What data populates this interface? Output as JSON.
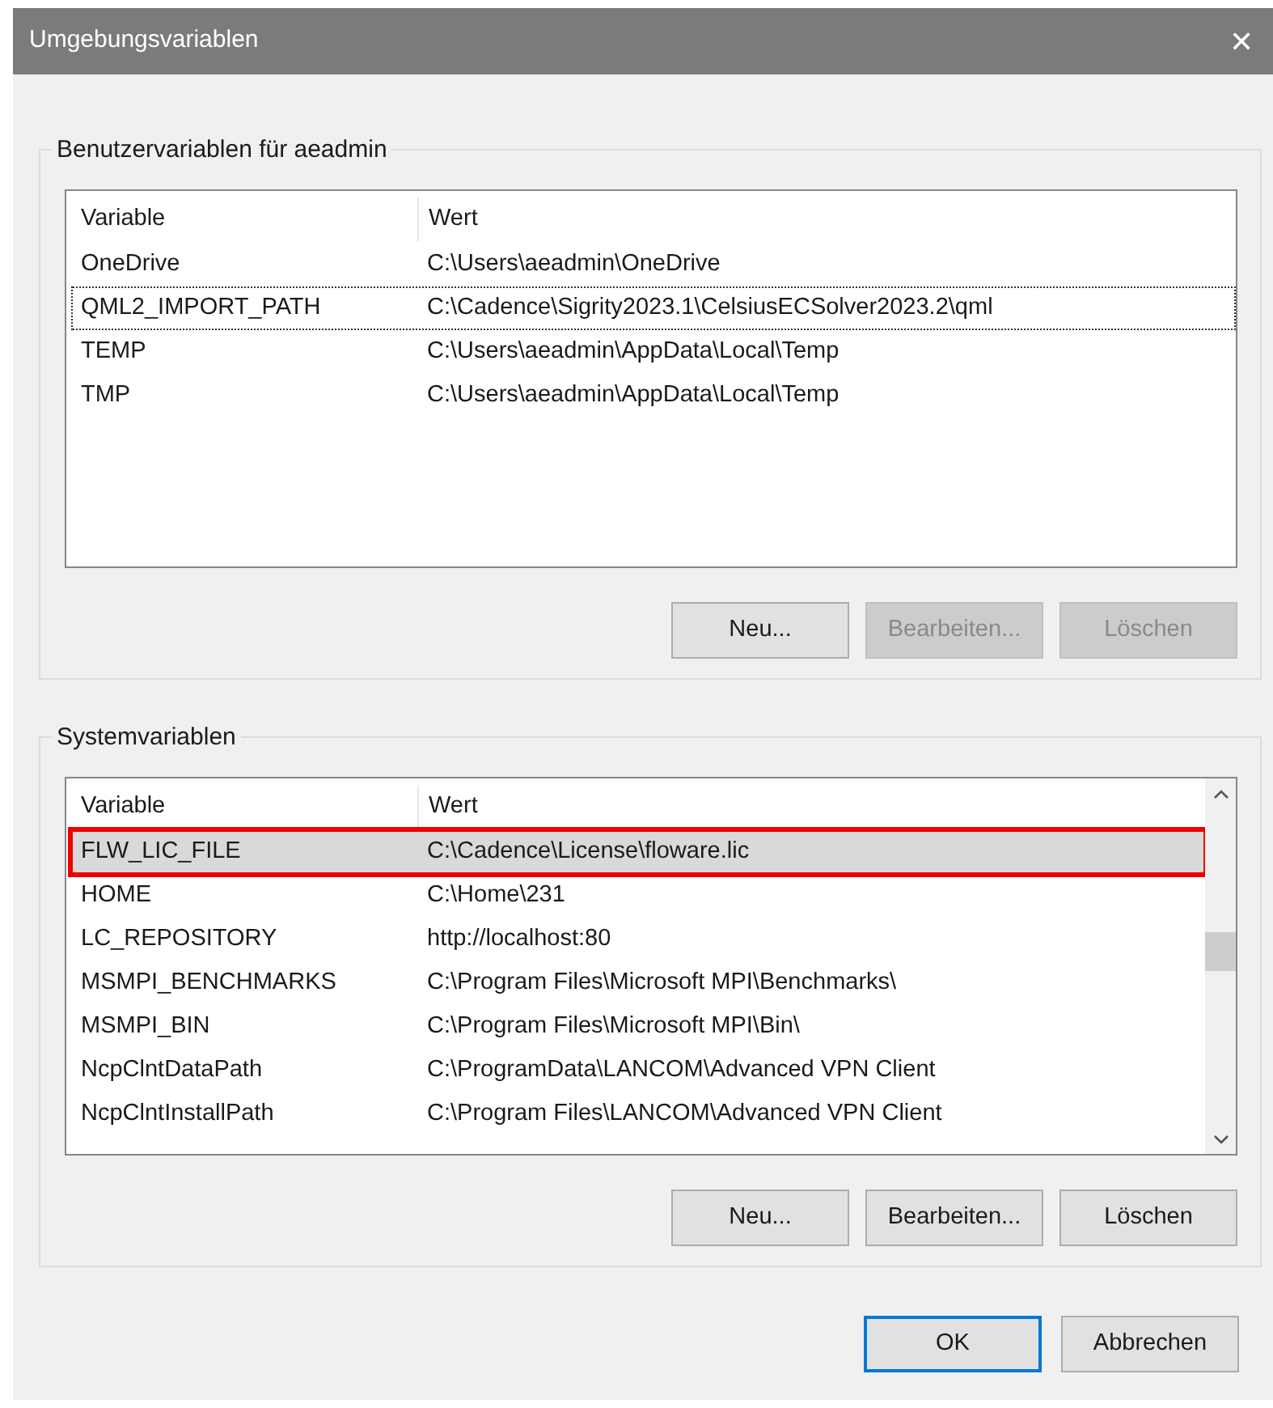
{
  "window": {
    "title": "Umgebungsvariablen",
    "close": "✕"
  },
  "groups": [
    {
      "title": "Benutzervariablen für aeadmin",
      "columns": [
        "Variable",
        "Wert"
      ],
      "scrollbar": false,
      "rows": [
        {
          "variable": "OneDrive",
          "value": "C:\\Users\\aeadmin\\OneDrive",
          "selected": false,
          "focused": false,
          "highlighted": false
        },
        {
          "variable": "QML2_IMPORT_PATH",
          "value": "C:\\Cadence\\Sigrity2023.1\\CelsiusECSolver2023.2\\qml",
          "selected": false,
          "focused": true,
          "highlighted": false
        },
        {
          "variable": "TEMP",
          "value": "C:\\Users\\aeadmin\\AppData\\Local\\Temp",
          "selected": false,
          "focused": false,
          "highlighted": false
        },
        {
          "variable": "TMP",
          "value": "C:\\Users\\aeadmin\\AppData\\Local\\Temp",
          "selected": false,
          "focused": false,
          "highlighted": false
        }
      ],
      "buttons": [
        {
          "label": "Neu...",
          "disabled": false
        },
        {
          "label": "Bearbeiten...",
          "disabled": true
        },
        {
          "label": "Löschen",
          "disabled": true
        }
      ]
    },
    {
      "title": "Systemvariablen",
      "columns": [
        "Variable",
        "Wert"
      ],
      "scrollbar": true,
      "rows": [
        {
          "variable": "FLW_LIC_FILE",
          "value": "C:\\Cadence\\License\\floware.lic",
          "selected": true,
          "focused": false,
          "highlighted": true
        },
        {
          "variable": "HOME",
          "value": "C:\\Home\\231",
          "selected": false,
          "focused": false,
          "highlighted": false
        },
        {
          "variable": "LC_REPOSITORY",
          "value": "http://localhost:80",
          "selected": false,
          "focused": false,
          "highlighted": false
        },
        {
          "variable": "MSMPI_BENCHMARKS",
          "value": "C:\\Program Files\\Microsoft MPI\\Benchmarks\\",
          "selected": false,
          "focused": false,
          "highlighted": false
        },
        {
          "variable": "MSMPI_BIN",
          "value": "C:\\Program Files\\Microsoft MPI\\Bin\\",
          "selected": false,
          "focused": false,
          "highlighted": false
        },
        {
          "variable": "NcpClntDataPath",
          "value": "C:\\ProgramData\\LANCOM\\Advanced VPN Client",
          "selected": false,
          "focused": false,
          "highlighted": false
        },
        {
          "variable": "NcpClntInstallPath",
          "value": "C:\\Program Files\\LANCOM\\Advanced VPN Client",
          "selected": false,
          "focused": false,
          "highlighted": false
        }
      ],
      "buttons": [
        {
          "label": "Neu...",
          "disabled": false
        },
        {
          "label": "Bearbeiten...",
          "disabled": false
        },
        {
          "label": "Löschen",
          "disabled": false
        }
      ]
    }
  ],
  "footer_buttons": [
    {
      "label": "OK",
      "default": true
    },
    {
      "label": "Abbrechen",
      "default": false
    }
  ]
}
